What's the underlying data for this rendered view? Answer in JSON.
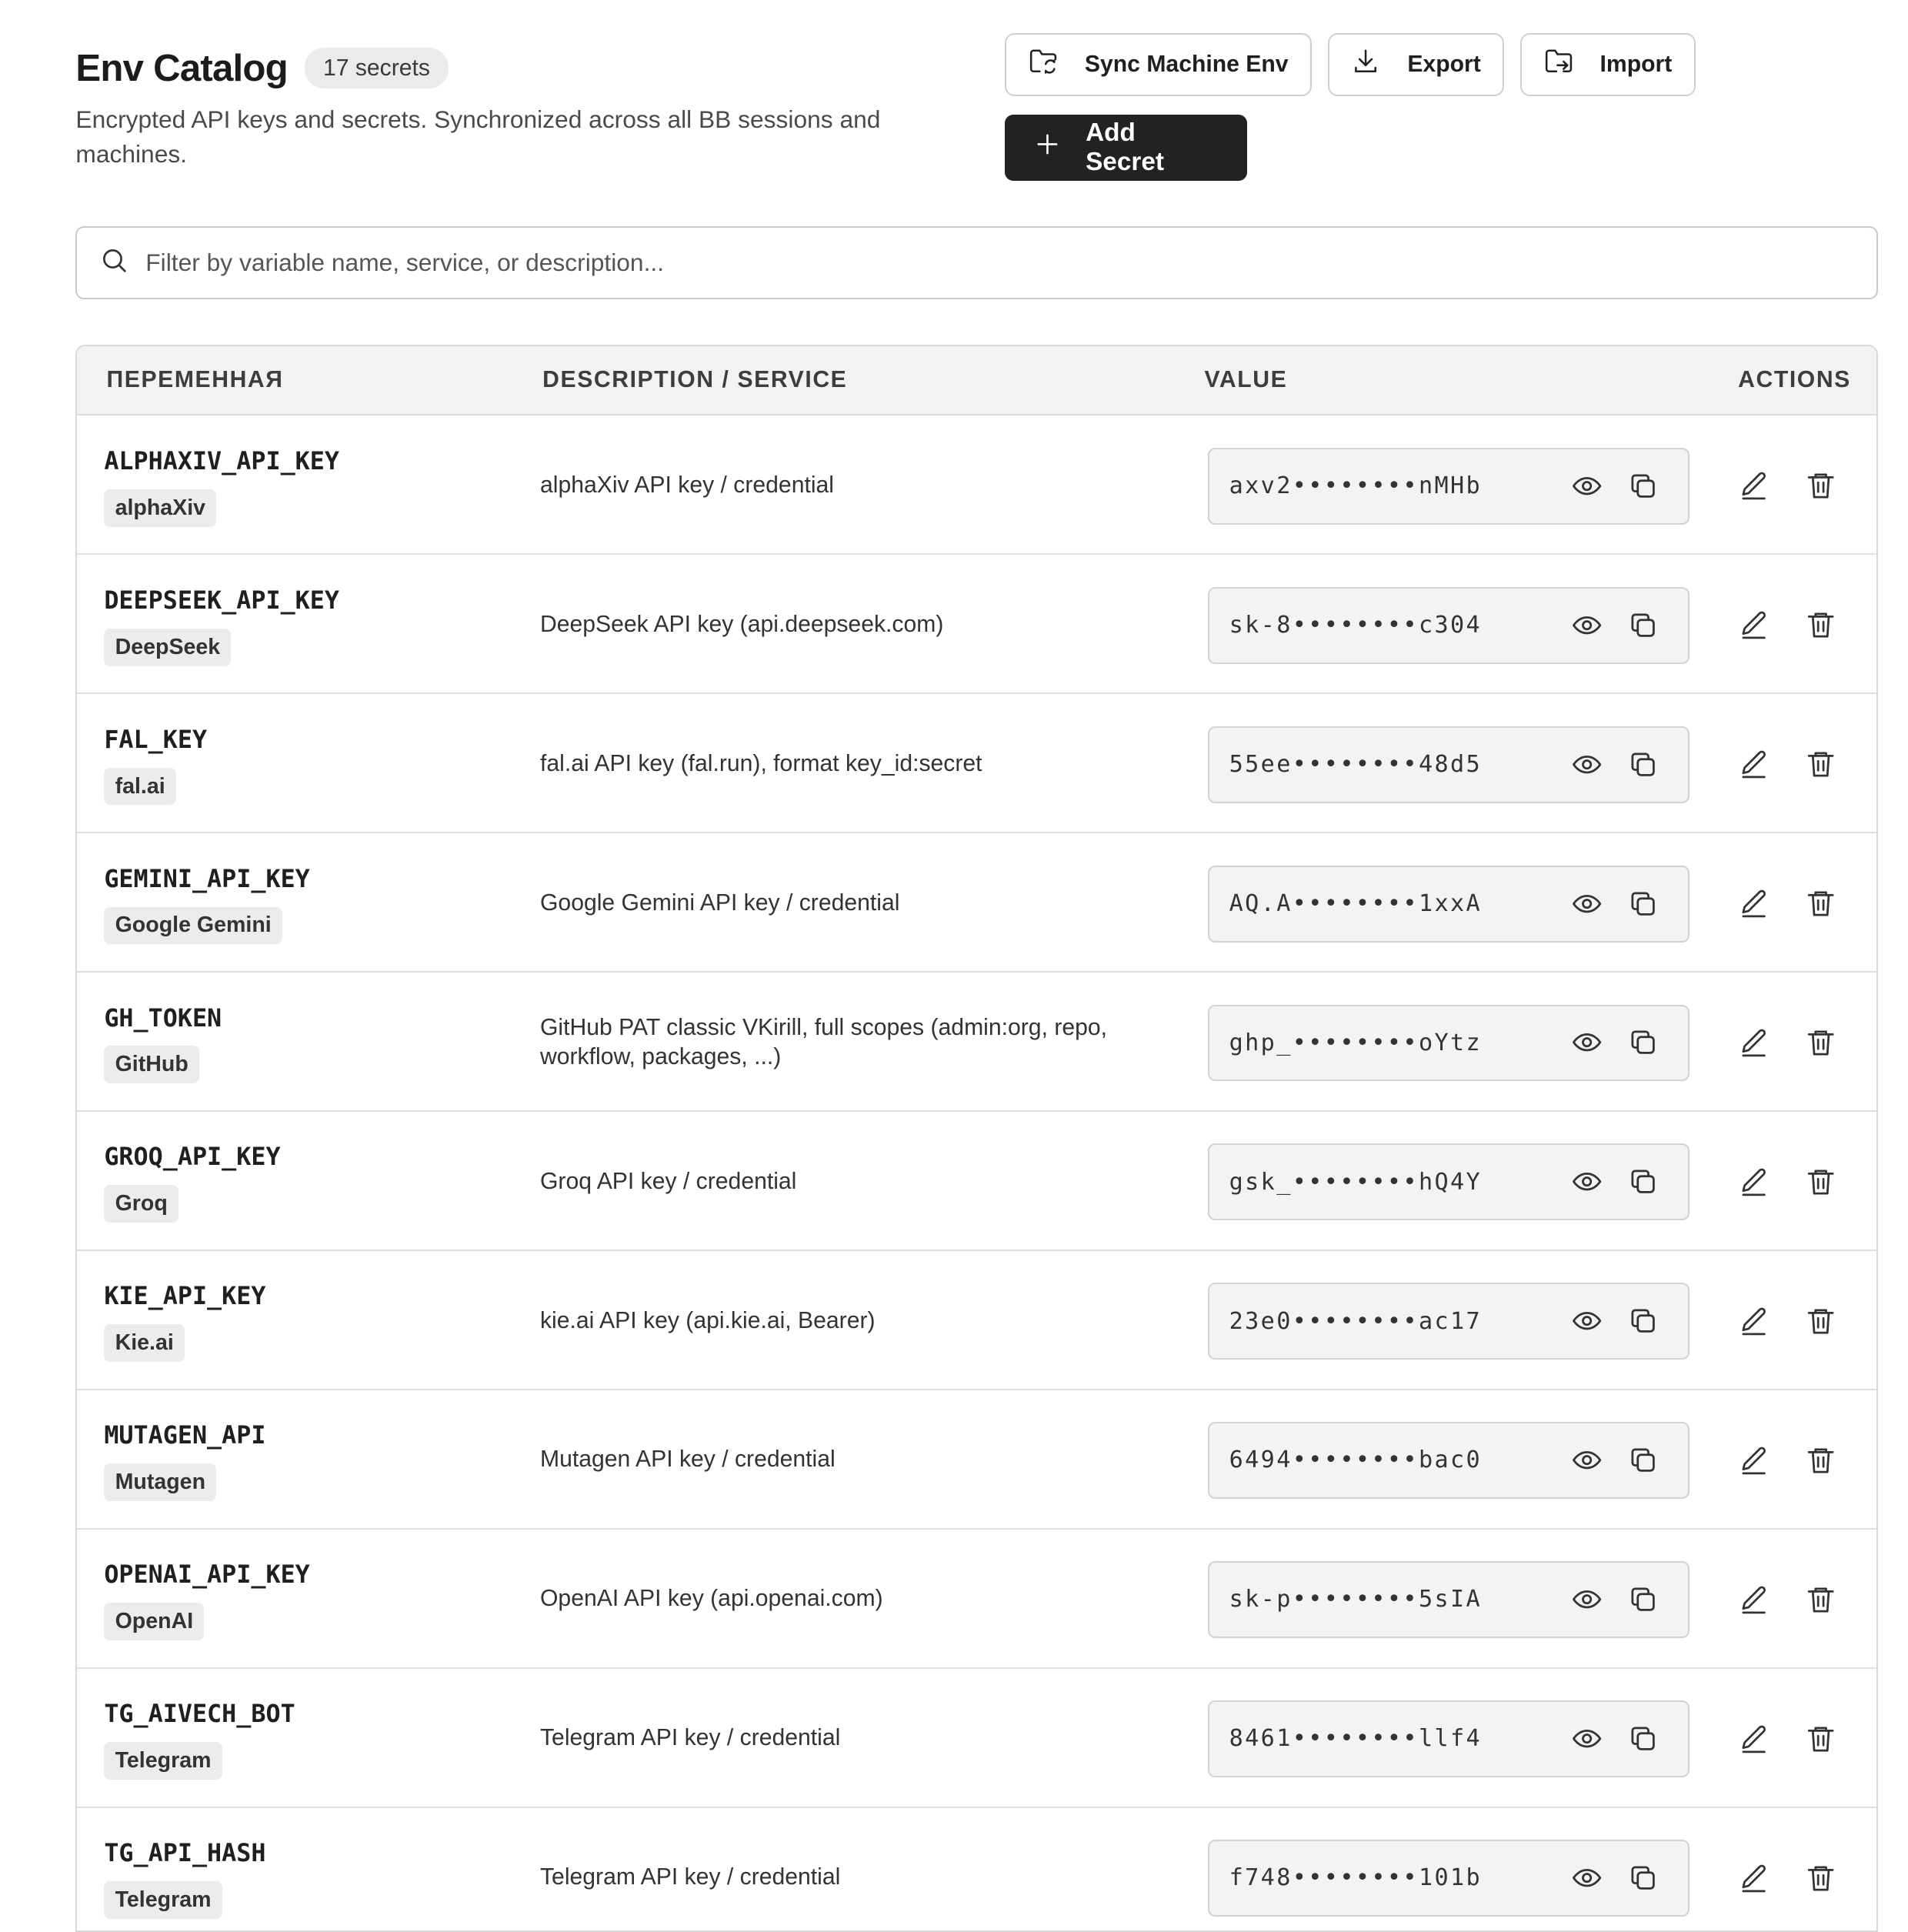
{
  "header": {
    "title": "Env Catalog",
    "count": "17 secrets",
    "subtitle": "Encrypted API keys and secrets. Synchronized across all BB sessions and machines."
  },
  "toolbar": {
    "sync_label": "Sync Machine Env",
    "export_label": "Export",
    "import_label": "Import",
    "add_label": "Add Secret"
  },
  "search": {
    "placeholder": "Filter by variable name, service, or description..."
  },
  "table": {
    "columns": [
      "ПЕРЕМЕННАЯ",
      "DESCRIPTION / SERVICE",
      "VALUE",
      "ACTIONS"
    ],
    "rows": [
      {
        "name": "ALPHAXIV_API_KEY",
        "service": "alphaXiv",
        "description": "alphaXiv API key / credential",
        "value": "axv2••••••••nMHb"
      },
      {
        "name": "DEEPSEEK_API_KEY",
        "service": "DeepSeek",
        "description": "DeepSeek API key (api.deepseek.com)",
        "value": "sk-8••••••••c304"
      },
      {
        "name": "FAL_KEY",
        "service": "fal.ai",
        "description": "fal.ai API key (fal.run), format key_id:secret",
        "value": "55ee••••••••48d5"
      },
      {
        "name": "GEMINI_API_KEY",
        "service": "Google Gemini",
        "description": "Google Gemini API key / credential",
        "value": "AQ.A••••••••1xxA"
      },
      {
        "name": "GH_TOKEN",
        "service": "GitHub",
        "description": "GitHub PAT classic VKirill, full scopes (admin:org, repo, workflow, packages, ...)",
        "value": "ghp_••••••••oYtz"
      },
      {
        "name": "GROQ_API_KEY",
        "service": "Groq",
        "description": "Groq API key / credential",
        "value": "gsk_••••••••hQ4Y"
      },
      {
        "name": "KIE_API_KEY",
        "service": "Kie.ai",
        "description": "kie.ai API key (api.kie.ai, Bearer)",
        "value": "23e0••••••••ac17"
      },
      {
        "name": "MUTAGEN_API",
        "service": "Mutagen",
        "description": "Mutagen API key / credential",
        "value": "6494••••••••bac0"
      },
      {
        "name": "OPENAI_API_KEY",
        "service": "OpenAI",
        "description": "OpenAI API key (api.openai.com)",
        "value": "sk-p••••••••5sIA"
      },
      {
        "name": "TG_AIVECH_BOT",
        "service": "Telegram",
        "description": "Telegram API key / credential",
        "value": "8461••••••••llf4"
      },
      {
        "name": "TG_API_HASH",
        "service": "Telegram",
        "description": "Telegram API key / credential",
        "value": "f748••••••••101b"
      }
    ]
  },
  "icons": {
    "sync": "folder-sync-icon",
    "export": "download-icon",
    "import": "folder-import-icon",
    "add": "plus-icon",
    "search": "search-icon",
    "reveal": "eye-icon",
    "copy": "copy-icon",
    "edit": "pencil-icon",
    "delete": "trash-icon"
  },
  "colors": {
    "primary_button": "#222222",
    "header_bg": "#f2f2f2",
    "value_bg": "#f3f3f3",
    "tag_bg": "#ececec"
  }
}
